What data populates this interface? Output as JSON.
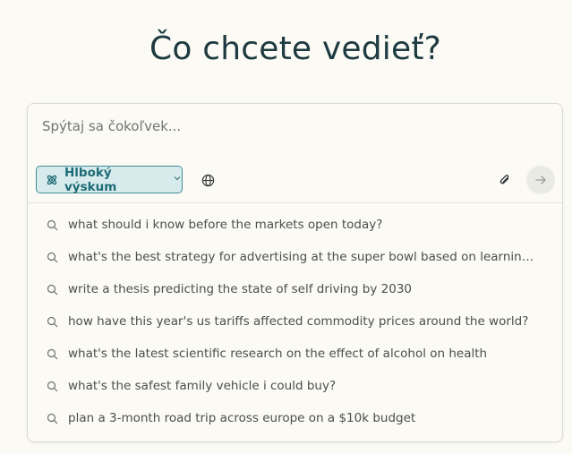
{
  "heading": "Čo chcete vedieť?",
  "search": {
    "placeholder": "Spýtaj sa čokoľvek...",
    "value": ""
  },
  "toolbar": {
    "mode_label": "Hlboký výskum",
    "mode_icon": "atom-icon",
    "globe_icon": "globe-icon",
    "attach_icon": "paperclip-icon",
    "send_icon": "arrow-right-icon"
  },
  "suggestions": [
    "what should i know before the markets open today?",
    "what's the best strategy for advertising at the super bowl based on learnings fr...",
    "write a thesis predicting the state of self driving by 2030",
    "how have this year's us tariffs affected commodity prices around the world?",
    "what's the latest scientific research on the effect of alcohol on health",
    "what's the safest family vehicle i could buy?",
    "plan a 3-month road trip across europe on a $10k budget"
  ],
  "colors": {
    "background": "#fbfaf4",
    "accent": "#1d6b75",
    "pill_background": "#d7ebed",
    "pill_border": "#3e8d96",
    "heading": "#1d3a40"
  }
}
